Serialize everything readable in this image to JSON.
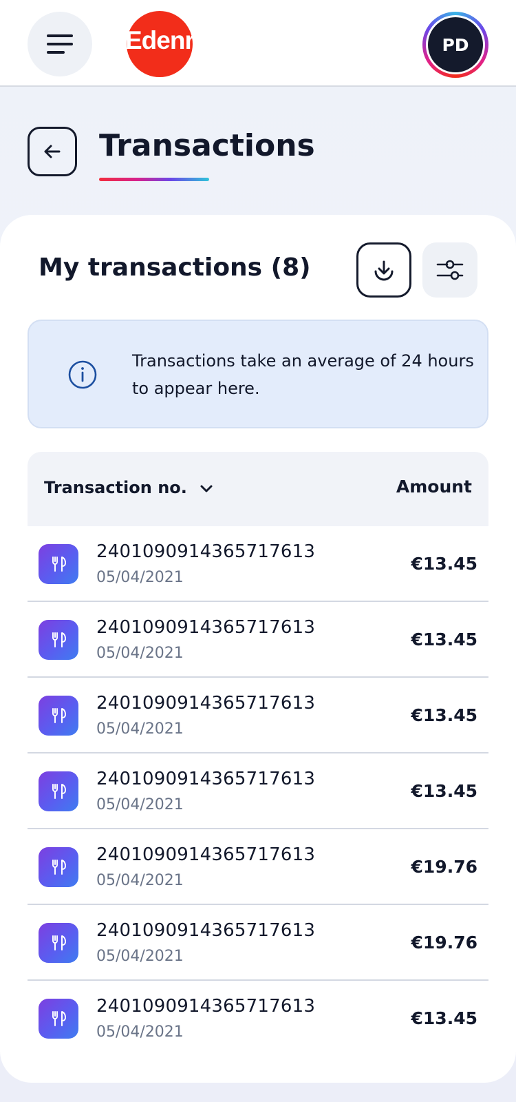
{
  "header": {
    "menu_icon": "hamburger-menu-icon",
    "logo_text": "Edenred",
    "avatar_initials": "PD"
  },
  "page": {
    "title": "Transactions",
    "back_icon": "arrow-left-icon"
  },
  "section": {
    "title": "My transactions (8)",
    "download_icon": "download-icon",
    "filter_icon": "sliders-filter-icon"
  },
  "info": {
    "icon": "info-circle-icon",
    "text": "Transactions take an average of 24 hours to appear here."
  },
  "table": {
    "col_transaction": "Transaction no.",
    "col_amount": "Amount",
    "sort_icon": "chevron-down-icon",
    "rows": [
      {
        "number": "2401090914365717613",
        "date": "05/04/2021",
        "amount": "€13.45",
        "icon": "fork-knife-icon"
      },
      {
        "number": "2401090914365717613",
        "date": "05/04/2021",
        "amount": "€13.45",
        "icon": "fork-knife-icon"
      },
      {
        "number": "2401090914365717613",
        "date": "05/04/2021",
        "amount": "€13.45",
        "icon": "fork-knife-icon"
      },
      {
        "number": "2401090914365717613",
        "date": "05/04/2021",
        "amount": "€13.45",
        "icon": "fork-knife-icon"
      },
      {
        "number": "2401090914365717613",
        "date": "05/04/2021",
        "amount": "€19.76",
        "icon": "fork-knife-icon"
      },
      {
        "number": "2401090914365717613",
        "date": "05/04/2021",
        "amount": "€19.76",
        "icon": "fork-knife-icon"
      },
      {
        "number": "2401090914365717613",
        "date": "05/04/2021",
        "amount": "€13.45",
        "icon": "fork-knife-icon"
      }
    ]
  },
  "colors": {
    "brand_red": "#f22d1a",
    "dark": "#12182b",
    "info_bg": "#e3ecfb",
    "icon_gradient_start": "#7d3fe0",
    "icon_gradient_end": "#3f7cf0"
  }
}
